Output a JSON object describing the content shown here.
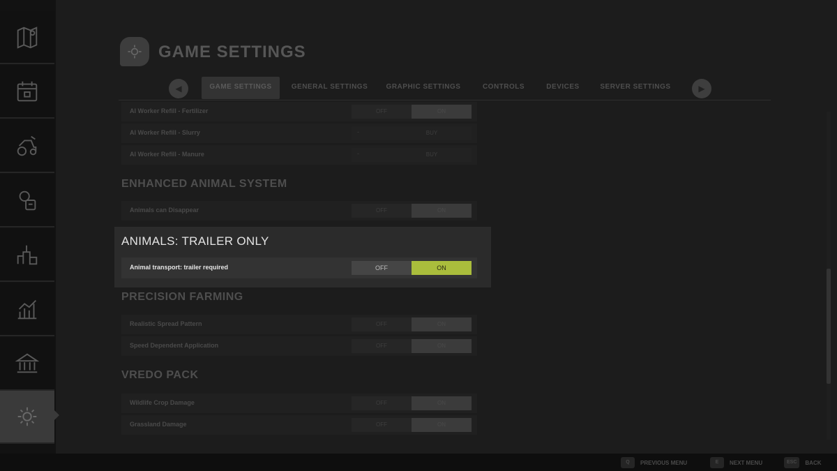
{
  "header": {
    "title": "GAME SETTINGS"
  },
  "tabs": [
    {
      "label": "GAME SETTINGS",
      "active": true
    },
    {
      "label": "GENERAL SETTINGS",
      "active": false
    },
    {
      "label": "GRAPHIC SETTINGS",
      "active": false
    },
    {
      "label": "CONTROLS",
      "active": false
    },
    {
      "label": "DEVICES",
      "active": false
    },
    {
      "label": "SERVER SETTINGS",
      "active": false
    }
  ],
  "sidebar": {
    "icons": [
      "map-icon",
      "calendar-icon",
      "vehicle-icon",
      "animals-icon",
      "production-icon",
      "statistics-icon",
      "finance-icon",
      "settings-icon"
    ],
    "active": "settings-icon"
  },
  "sections": {
    "worker": {
      "rows": [
        {
          "label": "AI Worker Refill - Fertilizer",
          "off": "OFF",
          "on": "ON"
        },
        {
          "label": "AI Worker Refill - Slurry",
          "minus": "-",
          "value": "BUY"
        },
        {
          "label": "AI Worker Refill - Manure",
          "minus": "-",
          "value": "BUY"
        }
      ]
    },
    "enhanced_animal": {
      "title": "ENHANCED ANIMAL SYSTEM",
      "rows": [
        {
          "label": "Animals can Disappear",
          "off": "OFF",
          "on": "ON"
        }
      ]
    },
    "trailer_only": {
      "title": "ANIMALS: TRAILER ONLY",
      "rows": [
        {
          "label": "Animal transport: trailer required",
          "off": "OFF",
          "on": "ON"
        }
      ]
    },
    "precision": {
      "title": "PRECISION FARMING",
      "rows": [
        {
          "label": "Realistic Spread Pattern",
          "off": "OFF",
          "on": "ON"
        },
        {
          "label": "Speed Dependent Application",
          "off": "OFF",
          "on": "ON"
        }
      ]
    },
    "vredo": {
      "title": "VREDO PACK",
      "rows": [
        {
          "label": "Wildlife Crop Damage",
          "off": "OFF",
          "on": "ON"
        },
        {
          "label": "Grassland Damage",
          "off": "OFF",
          "on": "ON"
        }
      ]
    }
  },
  "footer": {
    "prev": {
      "key": "Q",
      "label": "PREVIOUS MENU"
    },
    "next": {
      "key": "E",
      "label": "NEXT MENU"
    },
    "back": {
      "key": "ESC",
      "label": "BACK"
    }
  },
  "colors": {
    "accent_on": "#aabd3c",
    "background": "#1c1c1c",
    "highlight_panel": "#2b2b2b"
  }
}
